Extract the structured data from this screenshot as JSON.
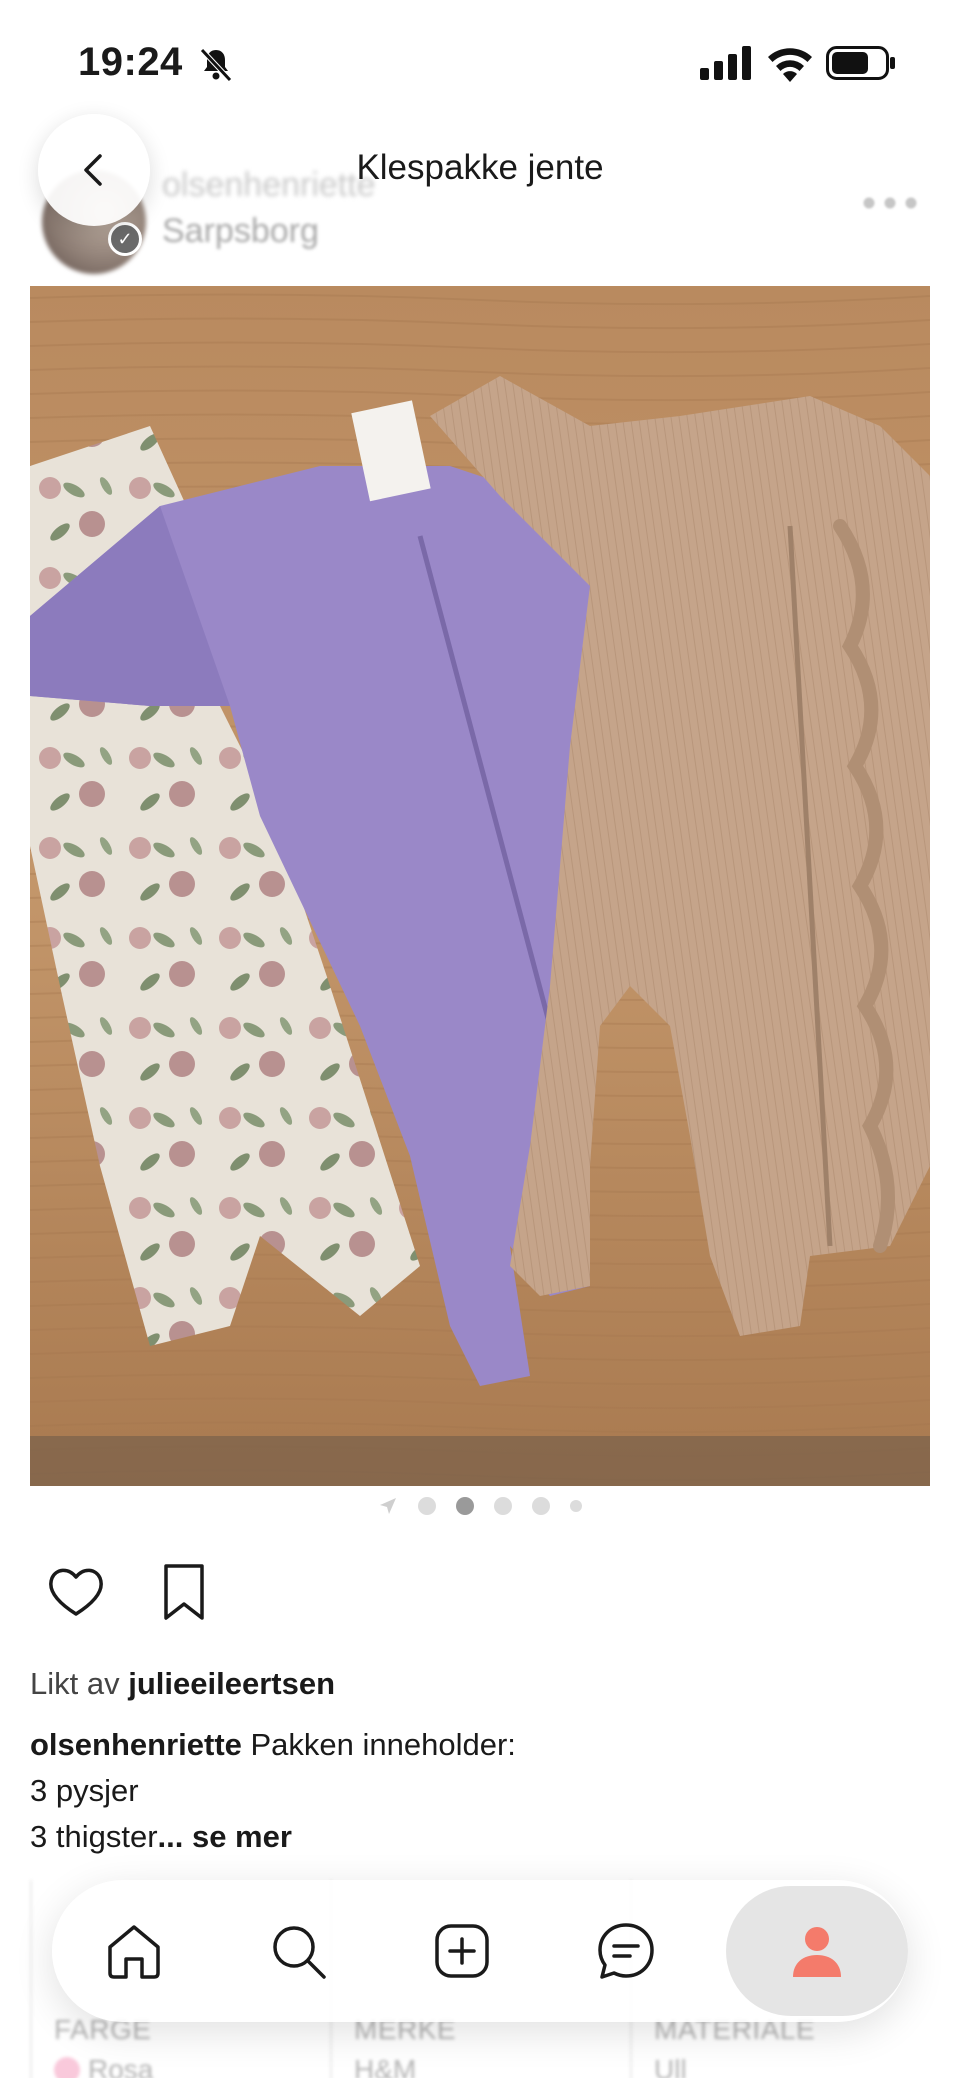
{
  "status_bar": {
    "time": "19:24"
  },
  "header": {
    "title": "Klespakke jente",
    "seller_name": "olsenhenriette",
    "seller_location": "Sarpsborg"
  },
  "carousel": {
    "total_dots": 5,
    "active_index": 1
  },
  "likes": {
    "prefix": "Likt av",
    "user": "julieeileertsen"
  },
  "description": {
    "author": "olsenhenriette",
    "line1": " Pakken inneholder:",
    "line2": "3 pysjer",
    "line3": "3 thigster",
    "more": "... se mer"
  },
  "attributes": [
    {
      "label": "FARGE",
      "value": "Rosa",
      "swatch": "#f7b7cf"
    },
    {
      "label": "MERKE",
      "value": "H&M"
    },
    {
      "label": "MATERIALE",
      "value": "Ull"
    }
  ],
  "nav": {
    "items": [
      "home-icon",
      "search-icon",
      "add-icon",
      "messages-icon",
      "profile-icon"
    ],
    "accent": "#f47b6b"
  }
}
